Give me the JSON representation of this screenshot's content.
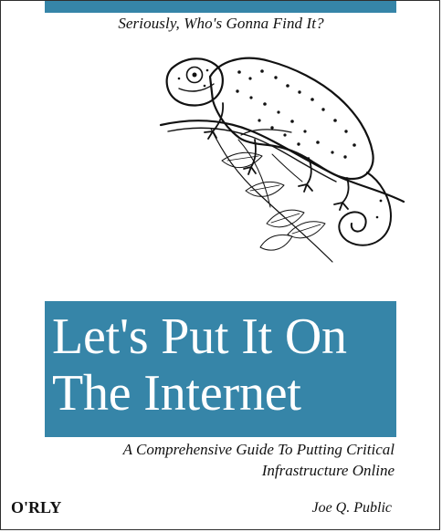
{
  "cover": {
    "tagline": "Seriously, Who's Gonna Find It?",
    "title_line_1": "Let's Put It On",
    "title_line_2": "The Internet",
    "subtitle_line_1": "A Comprehensive Guide To Putting Critical",
    "subtitle_line_2": "Infrastructure Online",
    "publisher": "O'RLY",
    "author": "Joe Q. Public",
    "illustration": "chameleon-on-branch",
    "accent_color": "#3685a8"
  }
}
